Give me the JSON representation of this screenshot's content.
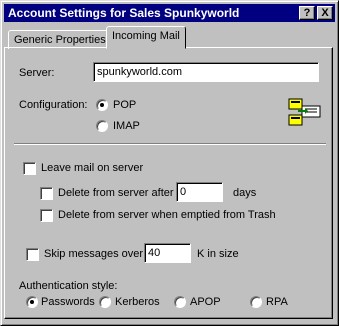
{
  "window": {
    "title": "Account Settings for Sales Spunkyworld",
    "help_button": "?",
    "close_button": "X"
  },
  "tabs": [
    {
      "label": "Generic Properties",
      "active": false
    },
    {
      "label": "Incoming Mail",
      "active": true
    }
  ],
  "server": {
    "label": "Server:",
    "value": "spunkyworld.com"
  },
  "configuration": {
    "label": "Configuration:",
    "options": [
      {
        "label": "POP",
        "selected": true
      },
      {
        "label": "IMAP",
        "selected": false
      }
    ],
    "icon": "configuration-icon"
  },
  "leave_mail": {
    "label": "Leave mail on server",
    "checked": false,
    "delete_after": {
      "label": "Delete from server after",
      "checked": false,
      "value": "0",
      "unit": "days"
    },
    "delete_trash": {
      "label": "Delete from server when emptied from Trash",
      "checked": false
    }
  },
  "skip": {
    "label": "Skip messages over",
    "checked": false,
    "value": "40",
    "unit": "K in size"
  },
  "auth": {
    "label": "Authentication style:",
    "options": [
      {
        "label": "Passwords",
        "selected": true
      },
      {
        "label": "Kerberos",
        "selected": false
      },
      {
        "label": "APOP",
        "selected": false
      },
      {
        "label": "RPA",
        "selected": false
      }
    ]
  },
  "colors": {
    "titlebar": "#000080",
    "face": "#c0c0c0"
  }
}
